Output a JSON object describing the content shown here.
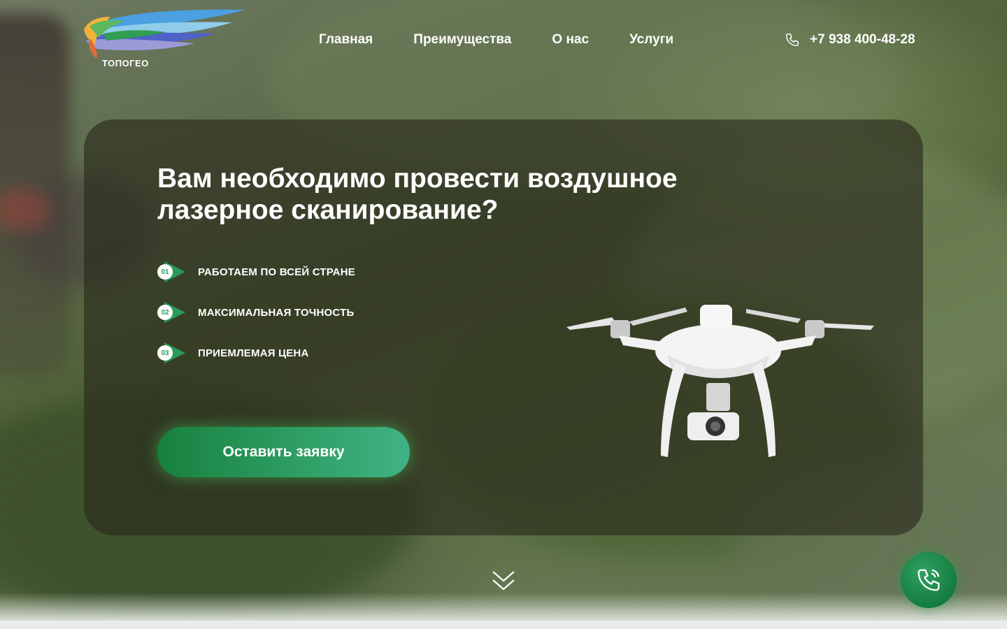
{
  "brand": {
    "name": "ТОПОГЕО",
    "logo_icon": "wing-logo-icon"
  },
  "nav": {
    "items": [
      {
        "label": "Главная"
      },
      {
        "label": "Преимущества"
      },
      {
        "label": "О нас"
      },
      {
        "label": "Услуги"
      }
    ]
  },
  "contact": {
    "phone": "+7 938 400-48-28",
    "icon": "phone-icon"
  },
  "hero": {
    "title": "Вам необходимо провести воздушное лазерное сканирование?",
    "features": [
      {
        "number": "01",
        "label": "РАБОТАЕМ ПО ВСЕЙ СТРАНЕ"
      },
      {
        "number": "02",
        "label": "МАКСИМАЛЬНАЯ ТОЧНОСТЬ"
      },
      {
        "number": "03",
        "label": "ПРИЕМЛЕМАЯ ЦЕНА"
      }
    ],
    "cta_label": "Оставить заявку",
    "image": "drone-image"
  },
  "scroll_indicator": {
    "icon": "double-chevron-down-icon"
  },
  "floating_call": {
    "icon": "phone-call-icon"
  },
  "colors": {
    "accent_green": "#17803f",
    "accent_green_light": "#40b285",
    "badge_number": "#2a9a56",
    "text": "#ffffff"
  }
}
